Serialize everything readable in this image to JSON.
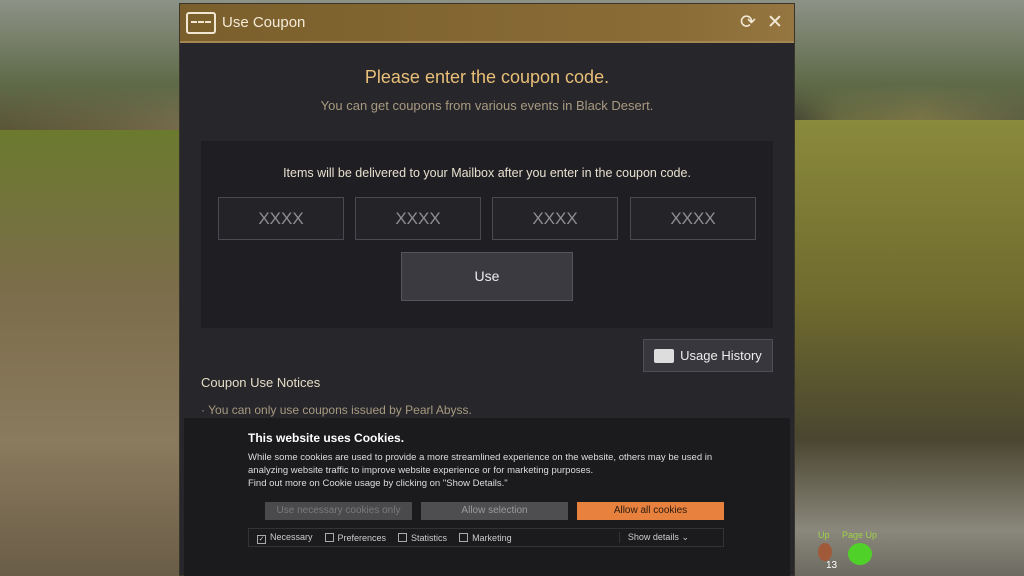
{
  "window": {
    "title": "Use Coupon",
    "heading": "Please enter the coupon code.",
    "subheading": "You can get coupons from various events in Black Desert."
  },
  "panel": {
    "note": "Items will be delivered to your Mailbox after you enter in the coupon code.",
    "inputs": [
      {
        "placeholder": "XXXX"
      },
      {
        "placeholder": "XXXX"
      },
      {
        "placeholder": "XXXX"
      },
      {
        "placeholder": "XXXX"
      }
    ],
    "use_label": "Use"
  },
  "usage_history_label": "Usage History",
  "notices": {
    "title": "Coupon Use Notices",
    "items": [
      "· You can only use coupons issued by Pearl Abyss."
    ]
  },
  "cookie": {
    "title": "This website uses Cookies.",
    "text": "While some cookies are used to provide a more streamlined experience on the website, others may be used in analyzing website traffic to improve website experience or for marketing purposes.",
    "text2": "Find out more on Cookie usage by clicking on \"Show Details.\"",
    "btn_necessary": "Use necessary cookies only",
    "btn_selection": "Allow selection",
    "btn_all": "Allow all cookies",
    "checks": [
      {
        "label": "Necessary",
        "checked": true
      },
      {
        "label": "Preferences",
        "checked": false
      },
      {
        "label": "Statistics",
        "checked": false
      },
      {
        "label": "Marketing",
        "checked": false
      }
    ],
    "show_details": "Show details",
    "accent": "#e8813e"
  },
  "hud": {
    "up": "Up",
    "page_up": "Page Up",
    "count": "13"
  }
}
